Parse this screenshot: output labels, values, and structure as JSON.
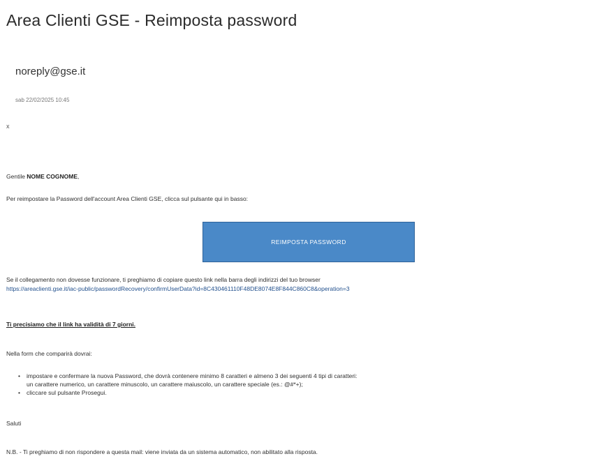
{
  "email": {
    "subject": "Area Clienti GSE - Reimposta password",
    "sender": "noreply@gse.it",
    "date": "sab 22/02/2025 10:45",
    "marker": "x"
  },
  "body": {
    "greeting_prefix": "Gentile ",
    "greeting_name": "NOME COGNOME",
    "greeting_suffix": ",",
    "instruction": "Per reimpostare la Password dell'account Area Clienti GSE, clicca sul pulsante qui in basso:",
    "button_label": "REIMPOSTA PASSWORD",
    "fallback_text": "Se il collegamento non dovesse funzionare, ti preghiamo di copiare questo link nella barra degli indirizzi del tuo browser",
    "reset_link": "https://areaclienti.gse.it/iac-public/passwordRecovery/confirmUserData?id=8C430461110F48DE8074E8F844C860C8&operation=3",
    "validity_note": "Ti precisiamo che il link ha validità di 7 giorni.",
    "form_intro": "Nella form che comparirà dovrai:",
    "steps": [
      {
        "line1": "impostare e confermare la nuova Password, che dovrà contenere minimo 8 caratteri e almeno 3 dei seguenti 4 tipi di caratteri:",
        "line2": "un carattere numerico, un carattere minuscolo, un carattere maiuscolo, un carattere speciale (es.: @#*+);"
      },
      {
        "line1": "cliccare sul pulsante Prosegui."
      }
    ],
    "sign_off": "Saluti",
    "footer_note": "N.B. - Ti preghiamo di non rispondere a questa mail: viene inviata da un sistema automatico, non abilitato alla risposta."
  }
}
